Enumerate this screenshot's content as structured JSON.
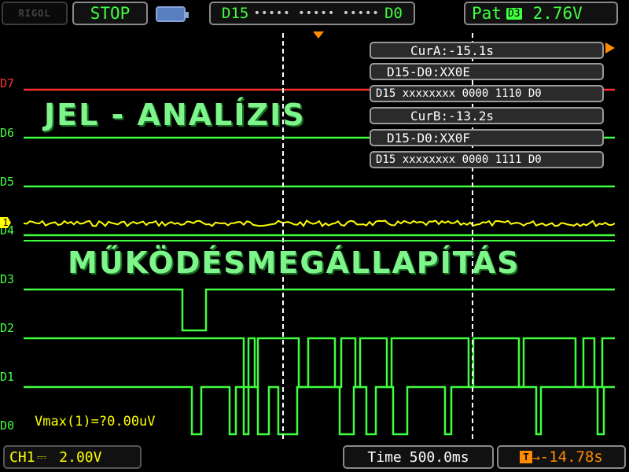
{
  "header": {
    "brand": "RIGOL",
    "run_state": "STOP",
    "channel_range_left": "D15",
    "channel_range_right": "D0",
    "trigger_mode": "Pat",
    "trigger_channel": "D3",
    "trigger_level": "2.76V"
  },
  "channels": [
    {
      "label": "D7",
      "color": "#ff3030"
    },
    {
      "label": "D6",
      "color": "#40ff40"
    },
    {
      "label": "D5",
      "color": "#40ff40"
    },
    {
      "label": "D4",
      "color": "#40ff40"
    },
    {
      "label": "D3",
      "color": "#40ff40"
    },
    {
      "label": "D2",
      "color": "#40ff40"
    },
    {
      "label": "D1",
      "color": "#40ff40"
    },
    {
      "label": "D0",
      "color": "#40ff40"
    }
  ],
  "analog_marker": "1",
  "cursors": {
    "cur_a": "CurA:-15.1s",
    "cur_a_hex": "D15-D0:XX0E",
    "cur_a_bin": "D15 xxxxxxxx 0000 1110 D0",
    "cur_b": "CurB:-13.2s",
    "cur_b_hex": "D15-D0:XX0F",
    "cur_b_bin": "D15 xxxxxxxx 0000 1111 D0"
  },
  "overlays": {
    "title_top": "JEL - ANALÍZIS",
    "title_middle": "MŰKÖDÉSMEGÁLLAPÍTÁS"
  },
  "measurement": "Vmax(1)=?0.00uV",
  "footer": {
    "ch1_label": "CH1",
    "ch1_coupling": "⎓",
    "ch1_scale": "2.00V",
    "time_label": "Time",
    "time_scale": "500.0ms",
    "trigger_offset": "-14.78s"
  },
  "colors": {
    "digital": "#40ff40",
    "high_channel": "#ff3030",
    "analog": "#ffff00",
    "cursor": "#ffffff",
    "trigger_marker": "#ff8c00"
  }
}
